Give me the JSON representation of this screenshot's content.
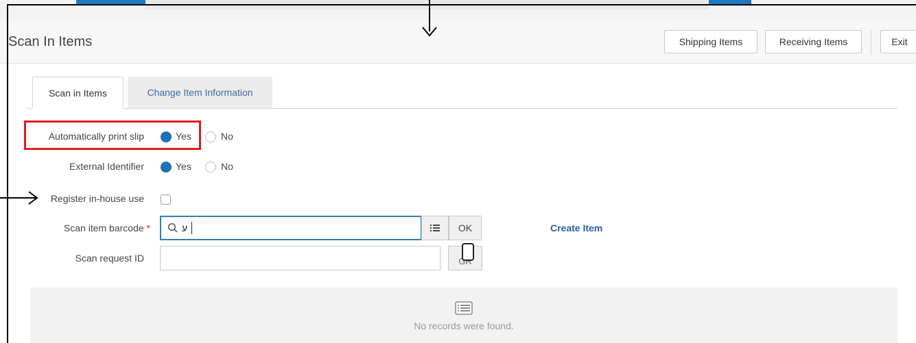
{
  "header": {
    "title": "Scan In Items",
    "buttons": {
      "shipping": "Shipping Items",
      "receiving": "Receiving Items",
      "exit": "Exit"
    }
  },
  "tabs": [
    {
      "label": "Scan in Items",
      "active": true
    },
    {
      "label": "Change Item Information",
      "active": false
    }
  ],
  "form": {
    "auto_print": {
      "label": "Automatically print slip",
      "yes": "Yes",
      "no": "No",
      "selected": "Yes"
    },
    "external_id": {
      "label": "External Identifier",
      "yes": "Yes",
      "no": "No",
      "selected": "Yes"
    },
    "in_house": {
      "label": "Register in-house use",
      "checked": false
    },
    "barcode": {
      "label": "Scan item barcode",
      "required_mark": "*",
      "value": "ע",
      "ok": "OK"
    },
    "create_item": "Create Item",
    "request": {
      "label": "Scan request ID",
      "value": "",
      "btn": "GR"
    }
  },
  "empty_state": {
    "text": "No records were found."
  },
  "colors": {
    "accent": "#1f6fb5",
    "link": "#2a5fa4",
    "highlight": "#e01b1b",
    "focus": "#2d7fb6"
  }
}
